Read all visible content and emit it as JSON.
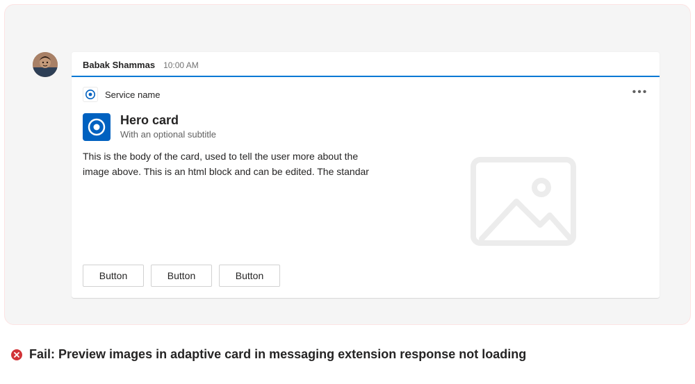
{
  "message": {
    "sender": "Babak Shammas",
    "timestamp": "10:00 AM"
  },
  "card": {
    "source_name": "Service name",
    "title": "Hero card",
    "subtitle": "With an optional subtitle",
    "body": "This is the body of the card, used to tell the user more about the image above. This is an html block and can be edited. The standar",
    "buttons": [
      "Button",
      "Button",
      "Button"
    ]
  },
  "caption": {
    "status": "Fail",
    "text": "Fail: Preview images in adaptive card in messaging extension response not loading"
  },
  "colors": {
    "accent": "#0078d4",
    "error": "#d13438",
    "frame_border": "#fde3e3",
    "canvas": "#f5f5f5"
  }
}
